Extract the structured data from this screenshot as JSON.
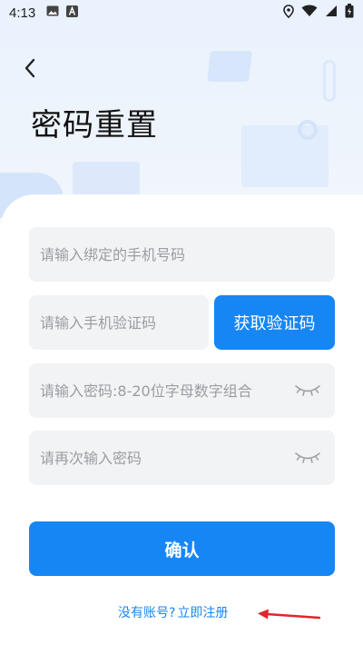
{
  "status_bar": {
    "time": "4:13",
    "left_icons": [
      "image-icon",
      "text-a-icon"
    ],
    "right_icons": [
      "location-icon",
      "wifi-icon",
      "signal-icon",
      "battery-icon"
    ]
  },
  "header": {
    "back_icon": "chevron-left-icon",
    "title": "密码重置"
  },
  "form": {
    "phone_placeholder": "请输入绑定的手机号码",
    "code_placeholder": "请输入手机验证码",
    "get_code_label": "获取验证码",
    "password_placeholder": "请输入密码:8-20位字母数字组合",
    "password_confirm_placeholder": "请再次输入密码",
    "eye_icon": "eye-closed-icon"
  },
  "confirm_label": "确认",
  "footer": {
    "no_account_text": "没有账号?",
    "register_link": "立即注册"
  },
  "colors": {
    "accent": "#1686f5",
    "annotation_arrow": "#e0262a",
    "field_bg": "#f2f3f5"
  }
}
